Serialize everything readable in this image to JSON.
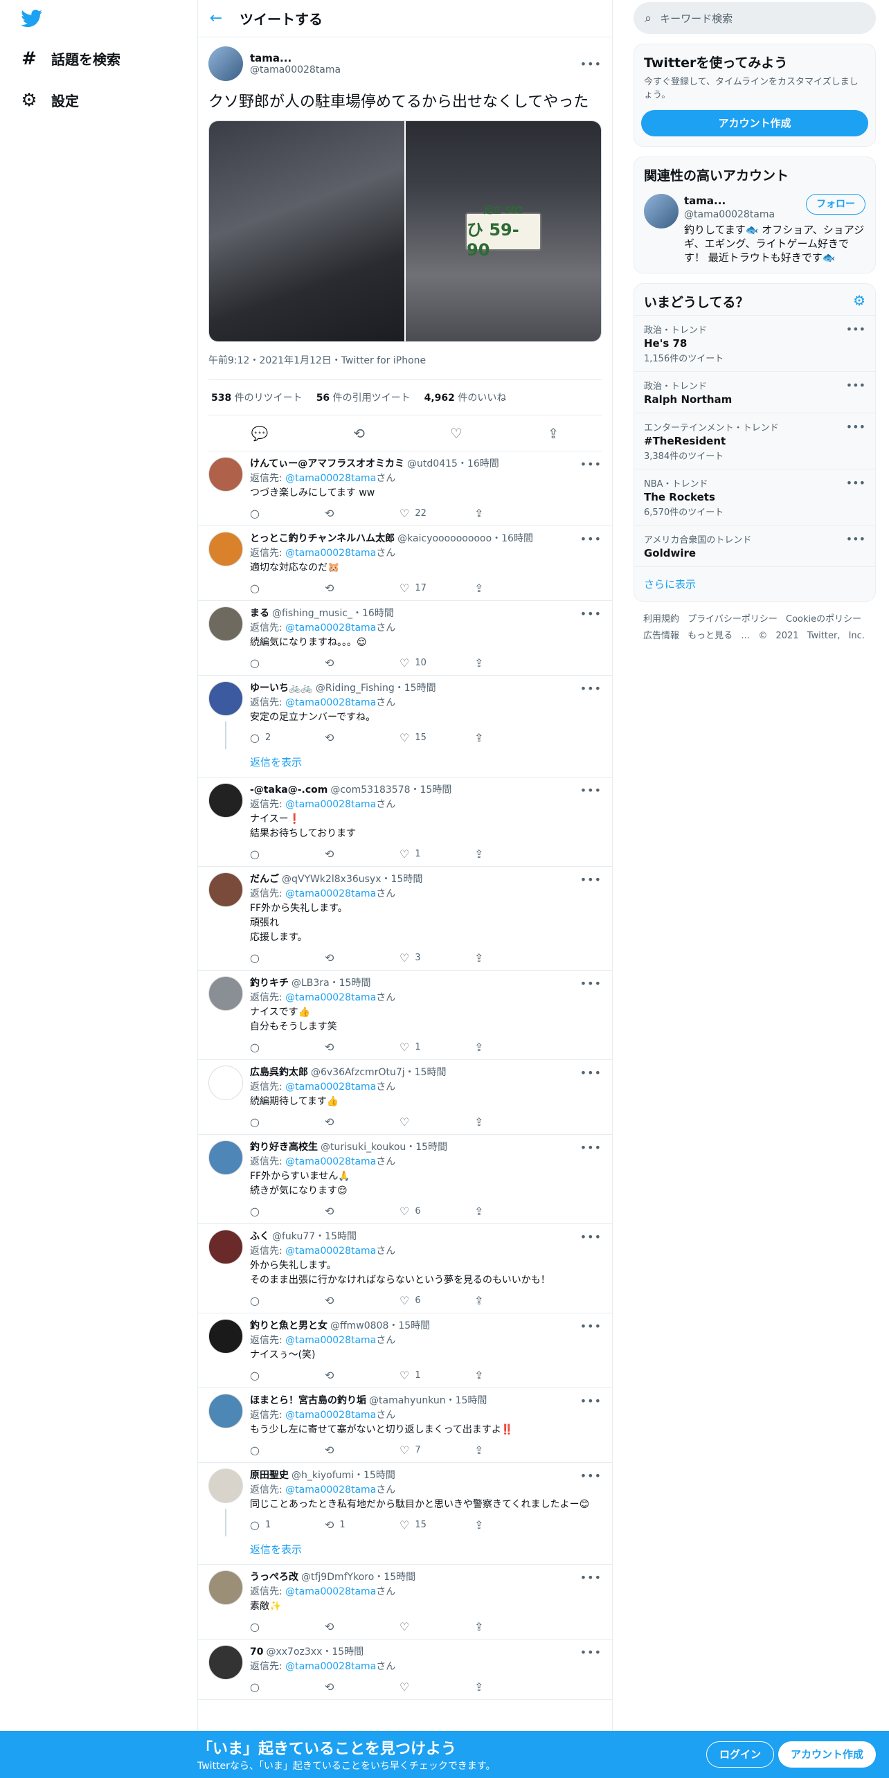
{
  "nav": {
    "search_label": "話題を検索",
    "settings_label": "設定"
  },
  "header": {
    "title": "ツイートする"
  },
  "tweet": {
    "name": "tama...",
    "handle": "@tama00028tama",
    "text": "クソ野郎が人の駐車場停めてるから出せなくしてやった",
    "plate_top": "足立 502",
    "plate_bottom": "ひ 59-90",
    "meta": "午前9:12・2021年1月12日・Twitter for iPhone",
    "retweets": "538",
    "retweets_label": "件のリツイート",
    "quotes": "56",
    "quotes_label": "件の引用ツイート",
    "likes": "4,962",
    "likes_label": "件のいいね"
  },
  "replies": [
    {
      "name": "けんてぃー@アマフラスオオミカミ",
      "handle": "@utd0415・16時間",
      "to": "@tama00028tama",
      "text": "つづき楽しみにしてます ww",
      "reply": "",
      "rt": "",
      "like": "22",
      "avatar": "#b0614a"
    },
    {
      "name": "とっとこ釣りチャンネルハム太郎",
      "handle": "@kaicyoooooooooo・16時間",
      "to": "@tama00028tama",
      "text": "適切な対応なのだ🐹",
      "reply": "",
      "rt": "",
      "like": "17",
      "avatar": "#d9822b"
    },
    {
      "name": "まる",
      "handle": "@fishing_music_・16時間",
      "to": "@tama00028tama",
      "text": "続編気になりますね。。。😌",
      "reply": "",
      "rt": "",
      "like": "10",
      "avatar": "#6e6a60"
    },
    {
      "name": "ゆーいち🚲🚲",
      "handle": "@Riding_Fishing・15時間",
      "to": "@tama00028tama",
      "text": "安定の足立ナンバーですね。",
      "reply": "2",
      "rt": "",
      "like": "15",
      "avatar": "#3b5aa0",
      "show": "返信を表示"
    },
    {
      "name": "-@taka@-.com",
      "handle": "@com53183578・15時間",
      "to": "@tama00028tama",
      "text": "ナイスー❗\n結果お待ちしております",
      "reply": "",
      "rt": "",
      "like": "1",
      "avatar": "#222222"
    },
    {
      "name": "だんご",
      "handle": "@qVYWk2l8x36usyx・15時間",
      "to": "@tama00028tama",
      "text": "FF外から失礼します。\n頑張れ\n応援します。",
      "reply": "",
      "rt": "",
      "like": "3",
      "avatar": "#7a4a3a"
    },
    {
      "name": "釣りキチ",
      "handle": "@LB3ra・15時間",
      "to": "@tama00028tama",
      "text": "ナイスです👍\n自分もそうします笑",
      "reply": "",
      "rt": "",
      "like": "1",
      "avatar": "#8a8f95"
    },
    {
      "name": "広島呉釣太郎",
      "handle": "@6v36AfzcmrOtu7j・15時間",
      "to": "@tama00028tama",
      "text": "続編期待してます👍",
      "reply": "",
      "rt": "",
      "like": "",
      "avatar": "#ffffff"
    },
    {
      "name": "釣り好き高校生",
      "handle": "@turisuki_koukou・15時間",
      "to": "@tama00028tama",
      "text": "FF外からすいません🙏\n続きが気になります😌",
      "reply": "",
      "rt": "",
      "like": "6",
      "avatar": "#4f86b8"
    },
    {
      "name": "ふく",
      "handle": "@fuku77・15時間",
      "to": "@tama00028tama",
      "text": "外から失礼します。\nそのまま出張に行かなければならないという夢を見るのもいいかも！",
      "reply": "",
      "rt": "",
      "like": "6",
      "avatar": "#6a2a2a"
    },
    {
      "name": "釣りと魚と男と女",
      "handle": "@ffmw0808・15時間",
      "to": "@tama00028tama",
      "text": "ナイスぅ〜(笑)",
      "reply": "",
      "rt": "",
      "like": "1",
      "avatar": "#1a1a1a"
    },
    {
      "name": "ほまとら！宮古島の釣り垢",
      "handle": "@tamahyunkun・15時間",
      "to": "@tama00028tama",
      "text": "もう少し左に寄せて塞がないと切り返しまくって出ますよ‼️",
      "reply": "",
      "rt": "",
      "like": "7",
      "avatar": "#4d87b5"
    },
    {
      "name": "原田聖史",
      "handle": "@h_kiyofumi・15時間",
      "to": "@tama00028tama",
      "text": "同じことあったとき私有地だから駄目かと思いきや警察きてくれましたよー😊",
      "reply": "1",
      "rt": "1",
      "like": "15",
      "avatar": "#d8d4cc",
      "show": "返信を表示"
    },
    {
      "name": "うっぺろ改",
      "handle": "@tfj9DmfYkoro・15時間",
      "to": "@tama00028tama",
      "text": "素敵✨",
      "reply": "",
      "rt": "",
      "like": "",
      "avatar": "#9c8f78"
    },
    {
      "name": "70",
      "handle": "@xx7oz3xx・15時間",
      "to": "@tama00028tama",
      "text": "",
      "reply": "",
      "rt": "",
      "like": "",
      "avatar": "#333333"
    }
  ],
  "reply_prefix": "返信先: ",
  "reply_suffix": "さん",
  "search": {
    "placeholder": "キーワード検索"
  },
  "signup": {
    "title": "Twitterを使ってみよう",
    "sub": "今すぐ登録して、タイムラインをカスタマイズしましょう。",
    "button": "アカウント作成"
  },
  "related": {
    "title": "関連性の高いアカウント",
    "name": "tama...",
    "handle": "@tama00028tama",
    "follow": "フォロー",
    "bio": "釣りしてます🐟 オフショア、ショアジギ、エギング、ライトゲーム好きです！ 最近トラウトも好きです🐟"
  },
  "trends": {
    "title": "いまどうしてる？",
    "items": [
      {
        "c": "政治・トレンド",
        "t": "He's 78",
        "n": "1,156件のツイート"
      },
      {
        "c": "政治・トレンド",
        "t": "Ralph Northam",
        "n": ""
      },
      {
        "c": "エンターテインメント・トレンド",
        "t": "#TheResident",
        "n": "3,384件のツイート"
      },
      {
        "c": "NBA・トレンド",
        "t": "The Rockets",
        "n": "6,570件のツイート"
      },
      {
        "c": "アメリカ合衆国のトレンド",
        "t": "Goldwire",
        "n": ""
      }
    ],
    "more": "さらに表示"
  },
  "footer": {
    "l1": "利用規約 プライバシーポリシー Cookieのポリシー",
    "l2": "広告情報 もっと見る … © 2021 Twitter, Inc."
  },
  "bottom": {
    "title": "「いま」起きていることを見つけよう",
    "sub": "Twitterなら、「いま」起きていることをいち早くチェックできます。",
    "login": "ログイン",
    "signup": "アカウント作成"
  },
  "colors": {
    "accent": "#1da1f2"
  }
}
